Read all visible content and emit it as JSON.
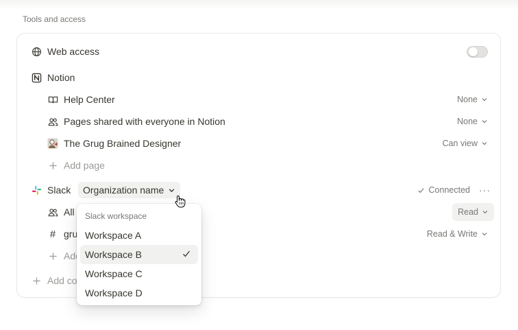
{
  "section": {
    "title": "Tools and access"
  },
  "web_access": {
    "label": "Web access",
    "enabled": false
  },
  "notion": {
    "label": "Notion",
    "pages": [
      {
        "label": "Help Center",
        "icon": "book-icon",
        "permission": "None"
      },
      {
        "label": "Pages shared with everyone in Notion",
        "icon": "people-icon",
        "permission": "None"
      },
      {
        "label": "The Grug Brained Designer",
        "icon": "page-avatar-icon",
        "permission": "Can view"
      }
    ],
    "add_page_label": "Add page"
  },
  "slack": {
    "label": "Slack",
    "org_selector": "Organization name",
    "status": "Connected",
    "channels": [
      {
        "label": "All",
        "icon": "people-icon",
        "permission": "Read"
      },
      {
        "label": "gru",
        "icon": "hash-icon",
        "permission": "Read & Write"
      }
    ],
    "add_label": "Add",
    "add_connection_label": "Add co"
  },
  "workspace_menu": {
    "header": "Slack workspace",
    "options": [
      "Workspace A",
      "Workspace B",
      "Workspace C",
      "Workspace D"
    ],
    "selected": "Workspace B"
  },
  "colors": {
    "text": "#37352f",
    "muted": "#787774",
    "hover_bg": "#f1f1ef",
    "border": "#e9e9e7"
  }
}
